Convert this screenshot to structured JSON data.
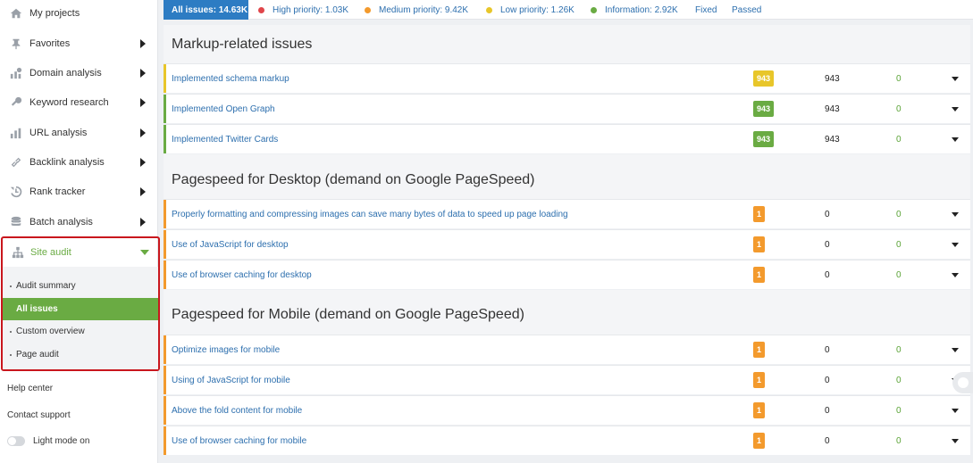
{
  "sidebar": {
    "items": [
      {
        "label": "My projects",
        "icon": "home-icon"
      },
      {
        "label": "Favorites",
        "icon": "pin-icon"
      },
      {
        "label": "Domain analysis",
        "icon": "domain-analysis-icon"
      },
      {
        "label": "Keyword research",
        "icon": "key-icon"
      },
      {
        "label": "URL analysis",
        "icon": "bar-chart-icon"
      },
      {
        "label": "Backlink analysis",
        "icon": "link-icon"
      },
      {
        "label": "Rank tracker",
        "icon": "history-icon"
      },
      {
        "label": "Batch analysis",
        "icon": "database-icon"
      }
    ],
    "site_audit": {
      "label": "Site audit",
      "icon": "sitemap-icon",
      "sub_items": [
        "Audit summary",
        "All issues",
        "Custom overview",
        "Page audit"
      ],
      "active": "All issues"
    },
    "help_center": "Help center",
    "contact_support": "Contact support",
    "light_mode": "Light mode on"
  },
  "filters": {
    "all_issues": "All issues: 14.63K",
    "high": "High priority: 1.03K",
    "medium": "Medium priority: 9.42K",
    "low": "Low priority: 1.26K",
    "info": "Information: 2.92K",
    "fixed": "Fixed",
    "passed": "Passed"
  },
  "colors": {
    "accent_blue": "#2d7cc3",
    "green": "#6aab43",
    "yellow": "#e8c62a",
    "orange": "#f39a2d",
    "red": "#e0454a",
    "highlight_red": "#c9161d"
  },
  "sections": [
    {
      "title": "Markup-related issues",
      "rows": [
        {
          "label": "Implemented schema markup",
          "badge": "943",
          "count": "943",
          "zero": "0"
        },
        {
          "label": "Implemented Open Graph",
          "badge": "943",
          "count": "943",
          "zero": "0"
        },
        {
          "label": "Implemented Twitter Cards",
          "badge": "943",
          "count": "943",
          "zero": "0"
        }
      ]
    },
    {
      "title": "Pagespeed for Desktop (demand on Google PageSpeed)",
      "rows": [
        {
          "label": "Properly formatting and compressing images can save many bytes of data to speed up page loading",
          "badge": "1",
          "count": "0",
          "zero": "0"
        },
        {
          "label": "Use of JavaScript for desktop",
          "badge": "1",
          "count": "0",
          "zero": "0"
        },
        {
          "label": "Use of browser caching for desktop",
          "badge": "1",
          "count": "0",
          "zero": "0"
        }
      ]
    },
    {
      "title": "Pagespeed for Mobile (demand on Google PageSpeed)",
      "rows": [
        {
          "label": "Optimize images for mobile",
          "badge": "1",
          "count": "0",
          "zero": "0"
        },
        {
          "label": "Using of JavaScript for mobile",
          "badge": "1",
          "count": "0",
          "zero": "0"
        },
        {
          "label": "Above the fold content for mobile",
          "badge": "1",
          "count": "0",
          "zero": "0"
        },
        {
          "label": "Use of browser caching for mobile",
          "badge": "1",
          "count": "0",
          "zero": "0"
        }
      ]
    }
  ]
}
